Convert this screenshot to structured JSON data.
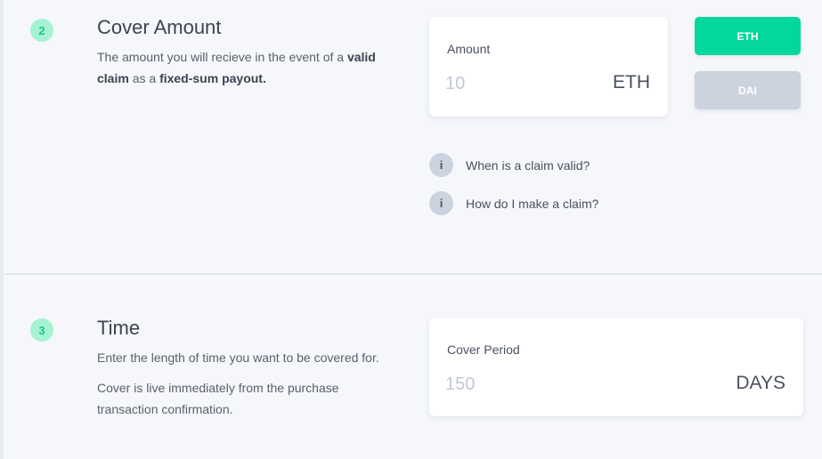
{
  "cover_amount": {
    "step": "2",
    "title": "Cover Amount",
    "desc_parts": [
      "The amount you will recieve in the event of a ",
      "valid claim",
      " as a ",
      "fixed-sum payout."
    ],
    "amount_label": "Amount",
    "amount_placeholder": "10",
    "amount_unit": "ETH",
    "currency_buttons": [
      {
        "label": "ETH",
        "selected": true
      },
      {
        "label": "DAI",
        "selected": false
      }
    ],
    "info_icon_glyph": "i",
    "info_links": [
      "When is a claim valid?",
      "How do I make a claim?"
    ]
  },
  "time": {
    "step": "3",
    "title": "Time",
    "desc_1": "Enter the length of time you want to be covered for.",
    "desc_2": "Cover is live immediately from the purchase transaction confirmation.",
    "period_label": "Cover Period",
    "period_placeholder": "150",
    "period_unit": "DAYS"
  },
  "colors": {
    "accent": "#04d79c",
    "badge_bg": "#a6f2d4",
    "badge_text": "#1fc493",
    "inactive_button": "#ccd3de",
    "background": "#f5f7fa"
  },
  "icons": {
    "info": "info-icon"
  }
}
